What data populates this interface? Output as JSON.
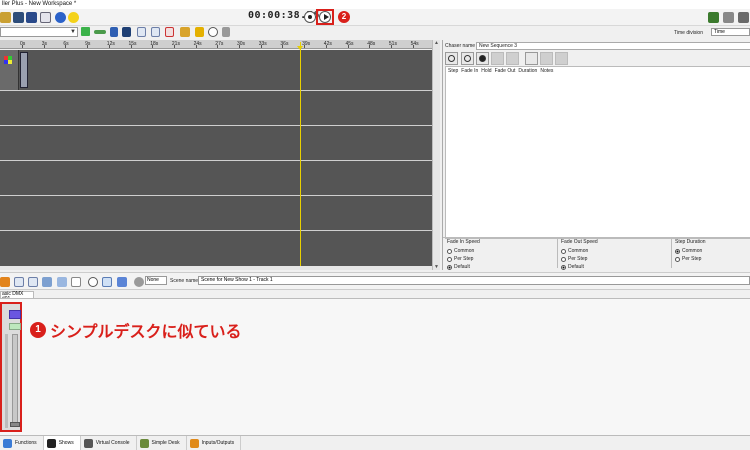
{
  "window": {
    "title": "ller Plus - New Workspace *"
  },
  "toolbar": {
    "timer": "00:00:38.76",
    "badge_2": "2",
    "time_division_label": "Time division",
    "time_division_value": "Time"
  },
  "timeline": {
    "ticks": [
      "0s",
      "3s",
      "6s",
      "9s",
      "12s",
      "15s",
      "18s",
      "21s",
      "24s",
      "27s",
      "30s",
      "33s",
      "36s",
      "39s",
      "42s",
      "45s",
      "48s",
      "51s",
      "54s"
    ],
    "cursor_time": "39s"
  },
  "chaser": {
    "name_label": "Chaser name",
    "name_value": "New Sequence 3",
    "columns": [
      "Step",
      "Fade In",
      "Hold",
      "Fade Out",
      "Duration",
      "Notes"
    ],
    "groups": [
      {
        "title": "Fade In Speed",
        "options": [
          "Common",
          "Per Step",
          "Default"
        ],
        "selected": 2
      },
      {
        "title": "Fade Out Speed",
        "options": [
          "Common",
          "Per Step",
          "Default"
        ],
        "selected": 2
      },
      {
        "title": "Step Duration",
        "options": [
          "Common",
          "Per Step"
        ],
        "selected": 0
      }
    ]
  },
  "lower_toolbar": {
    "mode_value": "None",
    "scene_label": "Scene name",
    "scene_value": "Scene for New Show 1 - Track 1"
  },
  "lower_panel": {
    "tab_label": "asic DMX #01",
    "annotation": "シンプルデスクに似ている",
    "badge_1": "1"
  },
  "bottom_tabs": [
    {
      "label": "Functions",
      "color": "#3a7bd5"
    },
    {
      "label": "Shows",
      "color": "#222222"
    },
    {
      "label": "Virtual Console",
      "color": "#555555"
    },
    {
      "label": "Simple Desk",
      "color": "#6a8a3a"
    },
    {
      "label": "Inputs/Outputs",
      "color": "#e08a1a"
    }
  ],
  "colors": {
    "accent_red": "#d9201b",
    "timeline_bg": "#555555",
    "cursor": "#e8d000"
  }
}
